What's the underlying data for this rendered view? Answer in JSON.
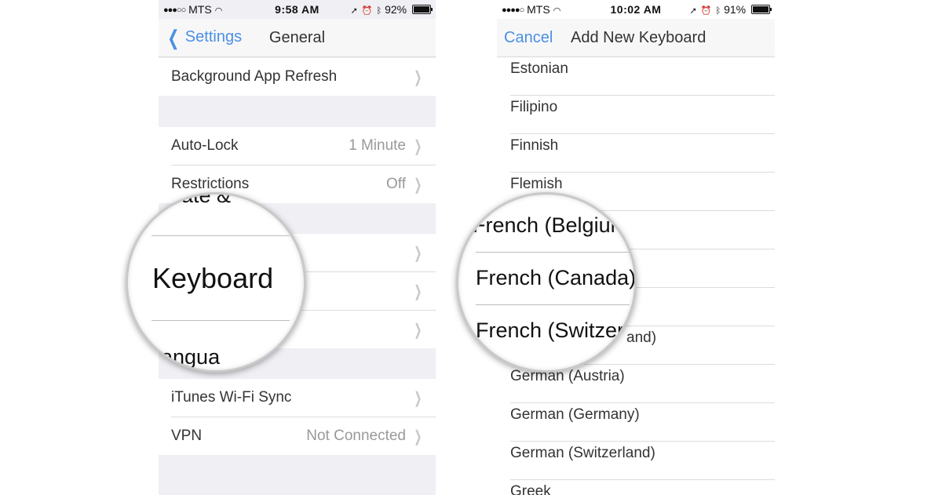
{
  "left": {
    "status": {
      "carrier": "MTS",
      "time": "9:58 AM",
      "battery": "92%",
      "battery_level": 0.92
    },
    "nav": {
      "back_label": "Settings",
      "title": "General"
    },
    "rows": {
      "background_refresh": "Background App Refresh",
      "auto_lock": "Auto-Lock",
      "auto_lock_value": "1 Minute",
      "restrictions": "Restrictions",
      "restrictions_value": "Off",
      "itunes_sync": "iTunes Wi-Fi Sync",
      "vpn": "VPN",
      "vpn_value": "Not Connected"
    },
    "magnifier": {
      "top_fragment": "ate &",
      "main": "Keyboard",
      "bottom_fragment": "angua"
    }
  },
  "right": {
    "status": {
      "carrier": "MTS",
      "time": "10:02 AM",
      "battery": "91%",
      "battery_level": 0.91
    },
    "nav": {
      "cancel_label": "Cancel",
      "title": "Add New Keyboard"
    },
    "languages": [
      "Estonian",
      "Filipino",
      "Finnish",
      "Flemish",
      "",
      "",
      "",
      "and)",
      "German (Austria)",
      "German (Germany)",
      "German (Switzerland)",
      "Greek"
    ],
    "magnifier": {
      "top": "French (Belgium",
      "middle": "French (Canada)",
      "bottom": "French (Switzerl"
    }
  },
  "icons": [
    "chevron-left-icon",
    "chevron-right-icon",
    "wifi-icon",
    "location-icon",
    "alarm-icon",
    "bluetooth-icon",
    "battery-icon"
  ]
}
